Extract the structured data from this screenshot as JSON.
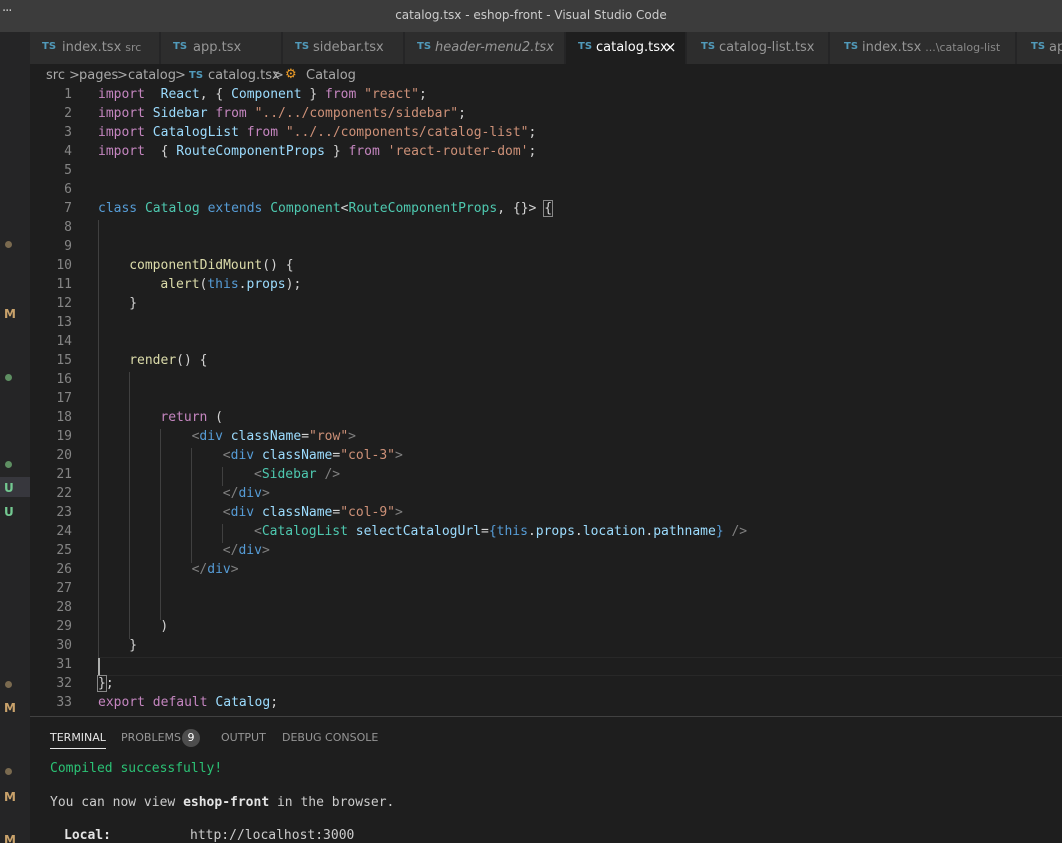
{
  "window": {
    "title": "catalog.tsx - eshop-front - Visual Studio Code"
  },
  "activity_bar": {
    "more_glyph": "···"
  },
  "scm_markers": [
    {
      "type": "dot",
      "color": "#7a6a4f"
    },
    {
      "type": "letter",
      "text": "M",
      "color": "#c9a26b"
    },
    {
      "type": "dot",
      "color": "#5e8f62"
    },
    {
      "type": "dot",
      "color": "#5e8f62"
    },
    {
      "type": "letter",
      "text": "U",
      "color": "#73c991"
    },
    {
      "type": "letter",
      "text": "U",
      "color": "#73c991"
    },
    {
      "type": "dot",
      "color": "#7a6a4f"
    },
    {
      "type": "letter",
      "text": "M",
      "color": "#c9a26b"
    },
    {
      "type": "dot",
      "color": "#7a6a4f"
    },
    {
      "type": "letter",
      "text": "M",
      "color": "#c9a26b"
    },
    {
      "type": "letter",
      "text": "M",
      "color": "#c9a26b"
    }
  ],
  "tabs": [
    {
      "icon": "TS",
      "label": "index.tsx",
      "desc": "src",
      "italic": false,
      "active": false
    },
    {
      "icon": "TS",
      "label": "app.tsx",
      "desc": "",
      "italic": false,
      "active": false
    },
    {
      "icon": "TS",
      "label": "sidebar.tsx",
      "desc": "",
      "italic": false,
      "active": false
    },
    {
      "icon": "TS",
      "label": "header-menu2.tsx",
      "desc": "",
      "italic": true,
      "active": false
    },
    {
      "icon": "TS",
      "label": "catalog.tsx",
      "desc": "",
      "italic": false,
      "active": true,
      "close": "×"
    },
    {
      "icon": "TS",
      "label": "catalog-list.tsx",
      "desc": "",
      "italic": false,
      "active": false
    },
    {
      "icon": "TS",
      "label": "index.tsx",
      "desc": "...\\catalog-list",
      "italic": false,
      "active": false
    },
    {
      "icon": "TS",
      "label": "ap",
      "desc": "",
      "italic": false,
      "active": false
    }
  ],
  "breadcrumb": {
    "items": [
      "src",
      "pages",
      "catalog"
    ],
    "file_icon": "TS",
    "file": "catalog.tsx",
    "symbol": "Catalog",
    "separator": ">"
  },
  "editor": {
    "line_numbers": [
      "1",
      "2",
      "3",
      "4",
      "5",
      "6",
      "7",
      "8",
      "9",
      "10",
      "11",
      "12",
      "13",
      "14",
      "15",
      "16",
      "17",
      "18",
      "19",
      "20",
      "21",
      "22",
      "23",
      "24",
      "25",
      "26",
      "27",
      "28",
      "29",
      "30",
      "31",
      "32",
      "33"
    ],
    "lines": [
      [
        [
          "k",
          "import"
        ],
        [
          "",
          "  "
        ],
        [
          "v",
          "React"
        ],
        [
          "",
          ", { "
        ],
        [
          "v",
          "Component"
        ],
        [
          "",
          " } "
        ],
        [
          "k",
          "from"
        ],
        [
          "",
          " "
        ],
        [
          "s",
          "\"react\""
        ],
        [
          "",
          ";"
        ]
      ],
      [
        [
          "k",
          "import"
        ],
        [
          "",
          " "
        ],
        [
          "v",
          "Sidebar"
        ],
        [
          "",
          " "
        ],
        [
          "k",
          "from"
        ],
        [
          "",
          " "
        ],
        [
          "s",
          "\"../../components/sidebar\""
        ],
        [
          "",
          ";"
        ]
      ],
      [
        [
          "k",
          "import"
        ],
        [
          "",
          " "
        ],
        [
          "v",
          "CatalogList"
        ],
        [
          "",
          " "
        ],
        [
          "k",
          "from"
        ],
        [
          "",
          " "
        ],
        [
          "s",
          "\"../../components/catalog-list\""
        ],
        [
          "",
          ";"
        ]
      ],
      [
        [
          "k",
          "import"
        ],
        [
          "",
          "  { "
        ],
        [
          "v",
          "RouteComponentProps"
        ],
        [
          "",
          " } "
        ],
        [
          "k",
          "from"
        ],
        [
          "",
          " "
        ],
        [
          "s",
          "'react-router-dom'"
        ],
        [
          "",
          ";"
        ]
      ],
      [],
      [],
      [
        [
          "b",
          "class"
        ],
        [
          "",
          " "
        ],
        [
          "t",
          "Catalog"
        ],
        [
          "",
          " "
        ],
        [
          "b",
          "extends"
        ],
        [
          "",
          " "
        ],
        [
          "t",
          "Component"
        ],
        [
          "",
          "<"
        ],
        [
          "t",
          "RouteComponentProps"
        ],
        [
          "",
          ", {}> "
        ],
        [
          "box",
          "{"
        ]
      ],
      [],
      [],
      [
        [
          "",
          ""
        ],
        [
          "f",
          "componentDidMount"
        ],
        [
          "",
          "() {"
        ]
      ],
      [
        [
          "",
          ""
        ],
        [
          "f",
          "alert"
        ],
        [
          "",
          "("
        ],
        [
          "b",
          "this"
        ],
        [
          "",
          "."
        ],
        [
          "v",
          "props"
        ],
        [
          "",
          ");"
        ]
      ],
      [
        [
          "",
          "}"
        ]
      ],
      [],
      [],
      [
        [
          "f",
          "render"
        ],
        [
          "",
          "() {"
        ]
      ],
      [],
      [],
      [
        [
          "k",
          "return"
        ],
        [
          "",
          " ("
        ]
      ],
      [
        [
          "g",
          "<"
        ],
        [
          "b",
          "div"
        ],
        [
          "",
          " "
        ],
        [
          "v",
          "className"
        ],
        [
          "",
          "="
        ],
        [
          "s",
          "\"row\""
        ],
        [
          "g",
          ">"
        ]
      ],
      [
        [
          "g",
          "<"
        ],
        [
          "b",
          "div"
        ],
        [
          "",
          " "
        ],
        [
          "v",
          "className"
        ],
        [
          "",
          "="
        ],
        [
          "s",
          "\"col-3\""
        ],
        [
          "g",
          ">"
        ]
      ],
      [
        [
          "g",
          "<"
        ],
        [
          "t",
          "Sidebar"
        ],
        [
          "",
          " "
        ],
        [
          "g",
          "/>"
        ]
      ],
      [
        [
          "g",
          "</"
        ],
        [
          "b",
          "div"
        ],
        [
          "g",
          ">"
        ]
      ],
      [
        [
          "g",
          "<"
        ],
        [
          "b",
          "div"
        ],
        [
          "",
          " "
        ],
        [
          "v",
          "className"
        ],
        [
          "",
          "="
        ],
        [
          "s",
          "\"col-9\""
        ],
        [
          "g",
          ">"
        ]
      ],
      [
        [
          "g",
          "<"
        ],
        [
          "t",
          "CatalogList"
        ],
        [
          "",
          " "
        ],
        [
          "v",
          "selectCatalogUrl"
        ],
        [
          "",
          "="
        ],
        [
          "b",
          "{"
        ],
        [
          "b",
          "this"
        ],
        [
          "",
          "."
        ],
        [
          "v",
          "props"
        ],
        [
          "",
          "."
        ],
        [
          "v",
          "location"
        ],
        [
          "",
          "."
        ],
        [
          "v",
          "pathname"
        ],
        [
          "b",
          "}"
        ],
        [
          "",
          " "
        ],
        [
          "g",
          "/>"
        ]
      ],
      [
        [
          "g",
          "</"
        ],
        [
          "b",
          "div"
        ],
        [
          "g",
          ">"
        ]
      ],
      [
        [
          "g",
          "</"
        ],
        [
          "b",
          "div"
        ],
        [
          "g",
          ">"
        ]
      ],
      [],
      [],
      [
        [
          "",
          ")"
        ]
      ],
      [
        [
          "",
          "}"
        ]
      ],
      [],
      [
        [
          "box",
          "}"
        ],
        [
          "",
          ";"
        ]
      ],
      [
        [
          "k",
          "export"
        ],
        [
          "",
          " "
        ],
        [
          "k",
          "default"
        ],
        [
          "",
          " "
        ],
        [
          "v",
          "Catalog"
        ],
        [
          "",
          ";"
        ]
      ]
    ],
    "indents": [
      0,
      0,
      0,
      0,
      0,
      0,
      0,
      0,
      0,
      4,
      8,
      4,
      0,
      0,
      4,
      0,
      0,
      8,
      12,
      16,
      20,
      16,
      16,
      20,
      16,
      12,
      0,
      0,
      8,
      4,
      0,
      0,
      0
    ]
  },
  "panel": {
    "tabs": [
      "TERMINAL",
      "PROBLEMS",
      "OUTPUT",
      "DEBUG CONSOLE"
    ],
    "problems_count": "9",
    "terminal": {
      "compiled": "Compiled successfully!",
      "view_prefix": "You can now view ",
      "app_name": "eshop-front",
      "view_suffix": " in the browser.",
      "local_label": "Local:",
      "local_url": "http://localhost:3000"
    }
  }
}
